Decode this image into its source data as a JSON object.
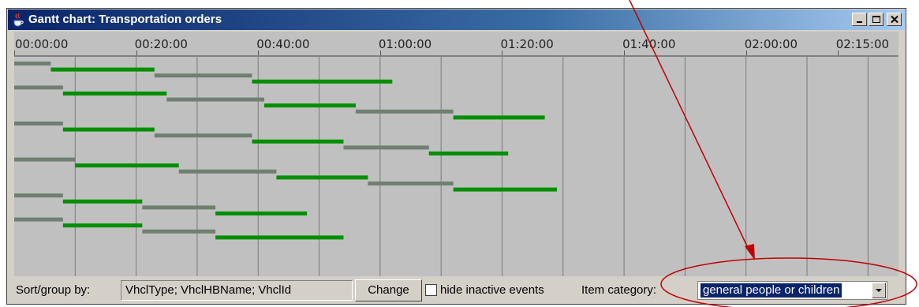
{
  "window": {
    "title": "Gantt chart: Transportation orders",
    "minimize": "_",
    "maximize": "□",
    "close": "×"
  },
  "timeline": {
    "ticks": [
      "00:00:00",
      "00:20:00",
      "00:40:00",
      "01:00:00",
      "01:20:00",
      "01:40:00",
      "02:00:00",
      "02:15:00"
    ],
    "tick_minutes": [
      0,
      20,
      40,
      60,
      80,
      100,
      120,
      135
    ]
  },
  "chart_data": {
    "type": "gantt",
    "time_unit": "minutes",
    "x_range": [
      0,
      145
    ],
    "colors": {
      "active": "#008f00",
      "inactive": "#6f8070",
      "background": "#c0c0c0",
      "gridline": "#7a7a7a"
    },
    "bars": [
      {
        "row": 0,
        "start": 0,
        "end": 6,
        "status": "inactive"
      },
      {
        "row": 1,
        "start": 6,
        "end": 23,
        "status": "active"
      },
      {
        "row": 2,
        "start": 23,
        "end": 39,
        "status": "inactive"
      },
      {
        "row": 3,
        "start": 39,
        "end": 62,
        "status": "active"
      },
      {
        "row": 4,
        "start": 0,
        "end": 8,
        "status": "inactive"
      },
      {
        "row": 5,
        "start": 8,
        "end": 25,
        "status": "active"
      },
      {
        "row": 6,
        "start": 25,
        "end": 41,
        "status": "inactive"
      },
      {
        "row": 7,
        "start": 41,
        "end": 56,
        "status": "active"
      },
      {
        "row": 8,
        "start": 56,
        "end": 72,
        "status": "inactive"
      },
      {
        "row": 9,
        "start": 72,
        "end": 87,
        "status": "active"
      },
      {
        "row": 10,
        "start": 0,
        "end": 8,
        "status": "inactive"
      },
      {
        "row": 11,
        "start": 8,
        "end": 23,
        "status": "active"
      },
      {
        "row": 12,
        "start": 23,
        "end": 39,
        "status": "inactive"
      },
      {
        "row": 13,
        "start": 39,
        "end": 54,
        "status": "active"
      },
      {
        "row": 14,
        "start": 54,
        "end": 68,
        "status": "inactive"
      },
      {
        "row": 15,
        "start": 68,
        "end": 81,
        "status": "active"
      },
      {
        "row": 16,
        "start": 0,
        "end": 10,
        "status": "inactive"
      },
      {
        "row": 17,
        "start": 10,
        "end": 27,
        "status": "active"
      },
      {
        "row": 18,
        "start": 27,
        "end": 43,
        "status": "inactive"
      },
      {
        "row": 19,
        "start": 43,
        "end": 58,
        "status": "active"
      },
      {
        "row": 20,
        "start": 58,
        "end": 72,
        "status": "inactive"
      },
      {
        "row": 21,
        "start": 72,
        "end": 89,
        "status": "active"
      },
      {
        "row": 22,
        "start": 0,
        "end": 8,
        "status": "inactive"
      },
      {
        "row": 23,
        "start": 8,
        "end": 21,
        "status": "active"
      },
      {
        "row": 24,
        "start": 21,
        "end": 33,
        "status": "inactive"
      },
      {
        "row": 25,
        "start": 33,
        "end": 48,
        "status": "active"
      },
      {
        "row": 26,
        "start": 0,
        "end": 8,
        "status": "inactive"
      },
      {
        "row": 27,
        "start": 8,
        "end": 21,
        "status": "active"
      },
      {
        "row": 28,
        "start": 21,
        "end": 33,
        "status": "inactive"
      },
      {
        "row": 29,
        "start": 33,
        "end": 54,
        "status": "active"
      }
    ]
  },
  "bottombar": {
    "sort_label": "Sort/group by:",
    "sort_value": "VhclType; VhclHBName; VhclId",
    "change_label": "Change",
    "hide_inactive_label": "hide inactive events",
    "hide_inactive_checked": false,
    "category_label": "Item category:",
    "category_value": "general people or children"
  },
  "annotation": {
    "color": "#c00000"
  }
}
